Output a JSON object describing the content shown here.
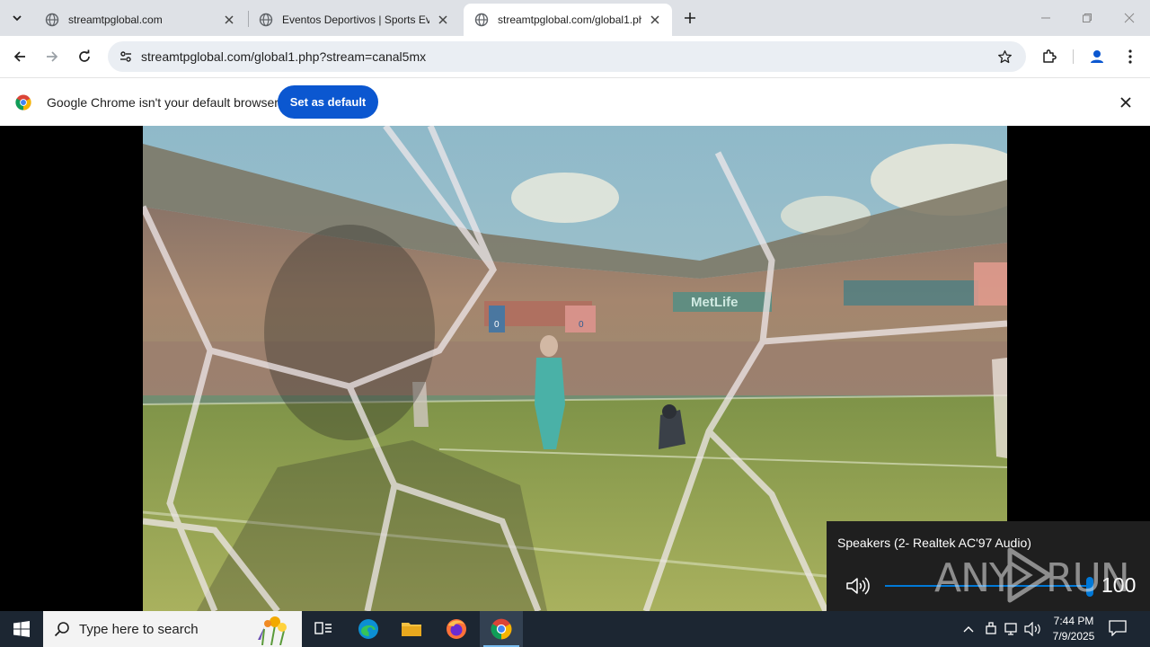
{
  "browser": {
    "tabs": [
      {
        "title": "streamtpglobal.com",
        "active": false
      },
      {
        "title": "Eventos Deportivos | Sports Eve",
        "active": false
      },
      {
        "title": "streamtpglobal.com/global1.ph",
        "active": true
      }
    ],
    "url": "streamtpglobal.com/global1.php?stream=canal5mx"
  },
  "infobar": {
    "message": "Google Chrome isn't your default browser",
    "button": "Set as default"
  },
  "video": {
    "stadium_sign": "MetLife",
    "scoreboard_left": "0",
    "scoreboard_right": "0"
  },
  "volume_flyout": {
    "device": "Speakers (2- Realtek AC'97 Audio)",
    "level": "100",
    "level_fraction": 1.0
  },
  "watermark": {
    "left": "ANY",
    "right": "RUN"
  },
  "taskbar": {
    "search_placeholder": "Type here to search",
    "time": "7:44 PM",
    "date": "7/9/2025"
  },
  "colors": {
    "accent": "#0b57d0",
    "volume": "#0078d7",
    "taskbar": "#1c2632"
  }
}
